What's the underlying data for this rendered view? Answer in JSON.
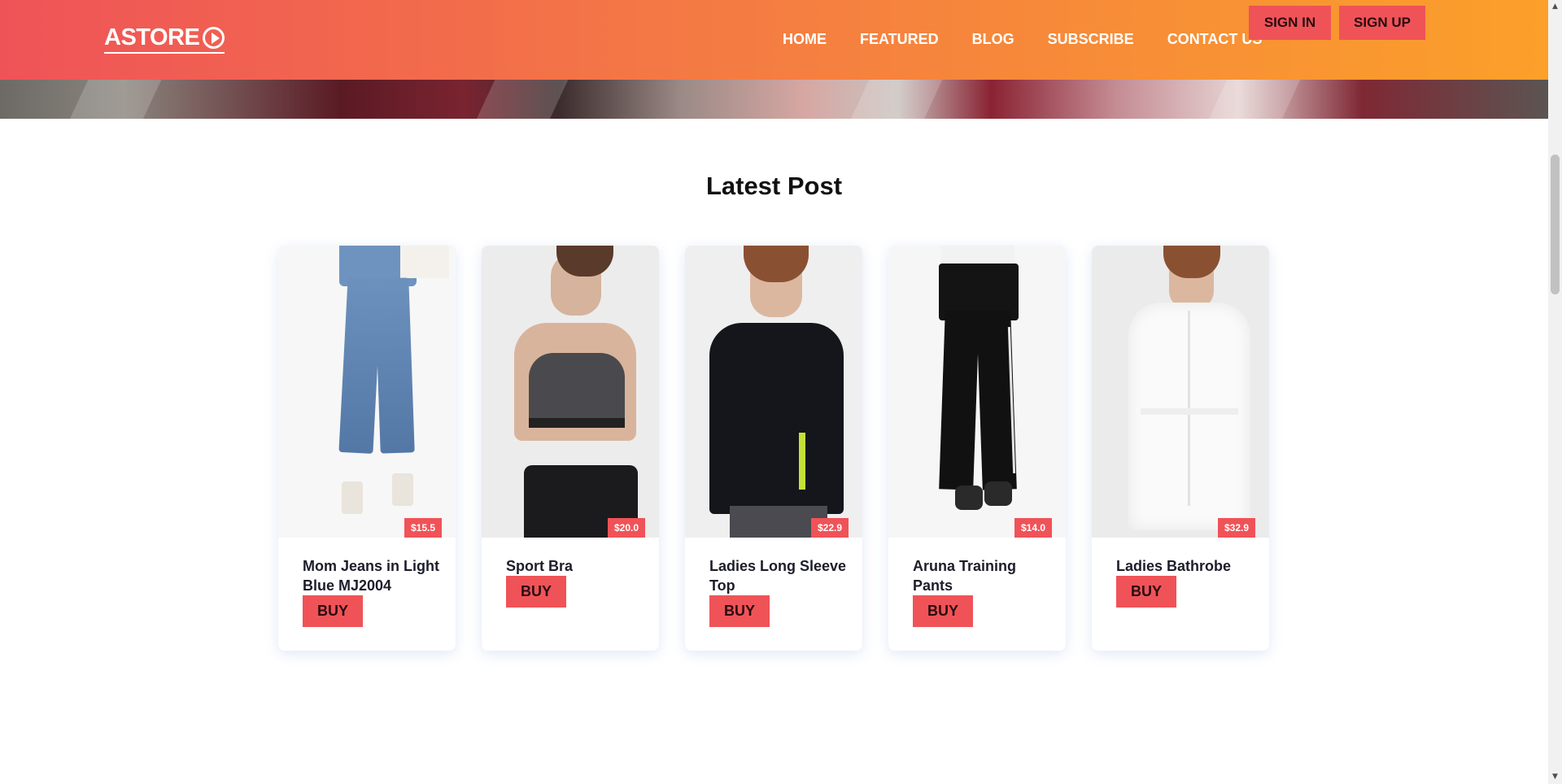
{
  "header": {
    "logo_text": "ASTORE",
    "nav": [
      "HOME",
      "FEATURED",
      "BLOG",
      "SUBSCRIBE",
      "CONTACT US"
    ],
    "sign_in": "SIGN IN",
    "sign_up": "SIGN UP"
  },
  "section": {
    "title": "Latest Post"
  },
  "products": [
    {
      "name": "Mom Jeans in Light Blue MJ2004",
      "price": "$15.5",
      "buy": "BUY"
    },
    {
      "name": "Sport Bra",
      "price": "$20.0",
      "buy": "BUY"
    },
    {
      "name": "Ladies Long Sleeve Top",
      "price": "$22.9",
      "buy": "BUY"
    },
    {
      "name": "Aruna Training Pants",
      "price": "$14.0",
      "buy": "BUY"
    },
    {
      "name": "Ladies Bathrobe",
      "price": "$32.9",
      "buy": "BUY"
    }
  ],
  "colors": {
    "accent": "#ef5358",
    "header_start": "#ef5358",
    "header_end": "#fba02a"
  }
}
